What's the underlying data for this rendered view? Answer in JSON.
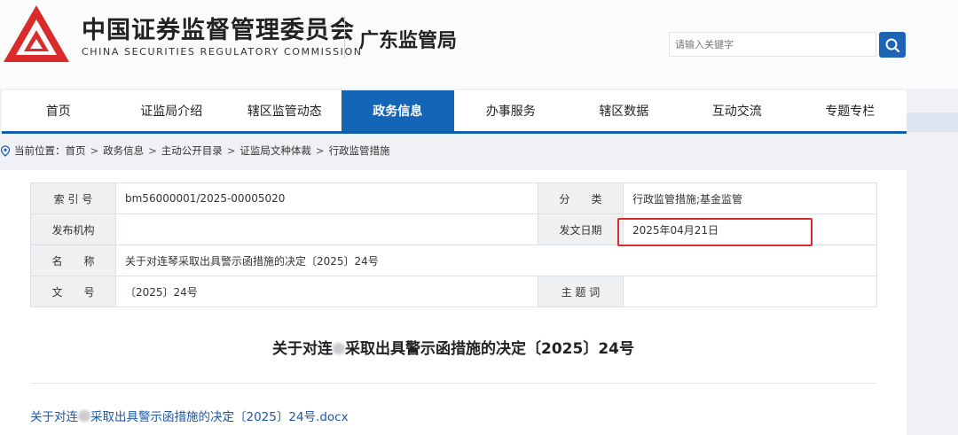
{
  "header": {
    "org_name_cn": "中国证券监督管理委员会",
    "org_name_en": "CHINA SECURITIES REGULATORY COMMISSION",
    "bureau": "广东监管局",
    "brand_color": "#d92b2b"
  },
  "search": {
    "placeholder": "请输入关键字",
    "icon": "search-icon"
  },
  "nav": {
    "items": [
      "首页",
      "证监局介绍",
      "辖区监管动态",
      "政务信息",
      "办事服务",
      "辖区数据",
      "互动交流",
      "专题专栏"
    ],
    "active": "政务信息",
    "accent": "#1565b7"
  },
  "breadcrumb": {
    "label": "当前位置：",
    "items": [
      "首页",
      "政务信息",
      "主动公开目录",
      "证监局文种体裁",
      "行政监管措施"
    ],
    "separator": ">"
  },
  "meta": {
    "index_label": "索 引 号",
    "index_value": "bm56000001/2025-00005020",
    "category_label": "分　　类",
    "category_value": "行政监管措施;基金监管",
    "publisher_label": "发布机构",
    "publisher_value": "",
    "date_label": "发文日期",
    "date_value": "2025年04月21日",
    "name_label": "名　　称",
    "name_value": "关于对连琴采取出具警示函措施的决定〔2025〕24号",
    "docno_label": "文　　号",
    "docno_value": "〔2025〕24号",
    "keywords_label": "主 题 词",
    "keywords_value": ""
  },
  "document": {
    "title_pre": "关于对连",
    "title_post": "采取出具警示函措施的决定〔2025〕24号",
    "attachment_pre": "关于对连",
    "attachment_post": "采取出具警示函措施的决定〔2025〕24号.docx"
  }
}
